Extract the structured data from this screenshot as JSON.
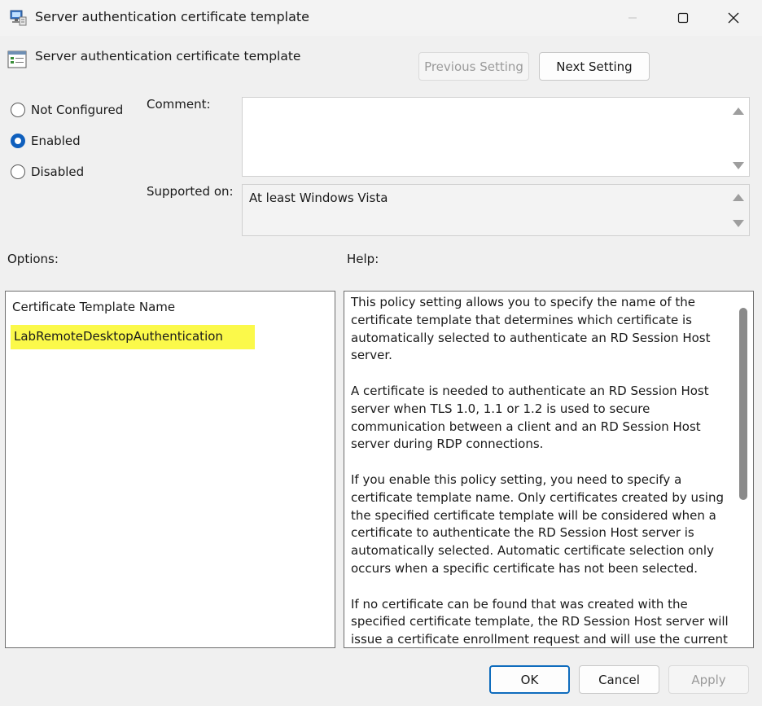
{
  "window": {
    "title": "Server authentication certificate template",
    "controls": {
      "minimize_icon": "minimize-icon",
      "maximize_icon": "maximize-icon",
      "close_icon": "close-icon"
    }
  },
  "header": {
    "title": "Server authentication certificate template",
    "previous_label": "Previous Setting",
    "next_label": "Next Setting"
  },
  "state": {
    "options": [
      "Not Configured",
      "Enabled",
      "Disabled"
    ],
    "selected": "Enabled"
  },
  "comment": {
    "label": "Comment:",
    "value": ""
  },
  "supported_on": {
    "label": "Supported on:",
    "value": "At least Windows Vista"
  },
  "options_panel": {
    "label": "Options:",
    "field_label": "Certificate Template Name",
    "field_value": "LabRemoteDesktopAuthentication",
    "highlight_color": "#fbf94a"
  },
  "help_panel": {
    "label": "Help:",
    "paragraphs": [
      "This policy setting allows you to specify the name of the certificate template that determines which certificate is automatically selected to authenticate an RD Session Host server.",
      "A certificate is needed to authenticate an RD Session Host server when TLS 1.0, 1.1 or 1.2 is used to secure communication between a client and an RD Session Host server during RDP connections.",
      "If you enable this policy setting, you need to specify a certificate template name. Only certificates created by using the specified certificate template will be considered when a certificate to authenticate the RD Session Host server is automatically selected. Automatic certificate selection only occurs when a specific certificate has not been selected.",
      "If no certificate can be found that was created with the specified certificate template, the RD Session Host server will issue a certificate enrollment request and will use the current certificate until the request is completed. If more than one certificate is found that was created with the specified certificate template, the"
    ]
  },
  "footer": {
    "ok_label": "OK",
    "cancel_label": "Cancel",
    "apply_label": "Apply"
  },
  "colors": {
    "accent": "#0f6cbd",
    "background": "#f0f0f0"
  }
}
